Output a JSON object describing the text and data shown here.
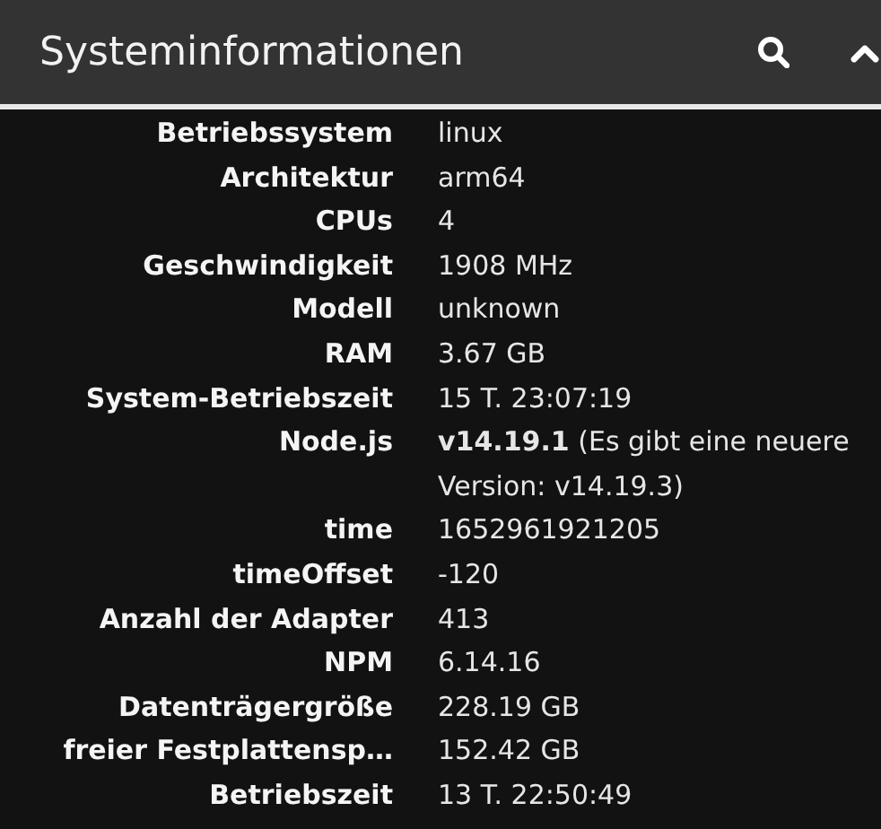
{
  "header": {
    "title": "Systeminformationen"
  },
  "rows": [
    {
      "label": "Betriebssystem",
      "value": "linux"
    },
    {
      "label": "Architektur",
      "value": "arm64"
    },
    {
      "label": "CPUs",
      "value": "4"
    },
    {
      "label": "Geschwindigkeit",
      "value": "1908 MHz"
    },
    {
      "label": "Modell",
      "value": "unknown"
    },
    {
      "label": "RAM",
      "value": "3.67 GB"
    },
    {
      "label": "System-Betriebszeit",
      "value": "15 T. 23:07:19"
    },
    {
      "label": "Node.js",
      "value": "**v14.19.1** (Es gibt eine neuere Version: v14.19.3)"
    },
    {
      "label": "time",
      "value": "1652961921205"
    },
    {
      "label": "timeOffset",
      "value": "-120"
    },
    {
      "label": "Anzahl der Adapter",
      "value": "413"
    },
    {
      "label": "NPM",
      "value": "6.14.16"
    },
    {
      "label": "Datenträgergröße",
      "value": "228.19 GB"
    },
    {
      "label": "freier Festplattensp…",
      "value": "152.42 GB"
    },
    {
      "label": "Betriebszeit",
      "value": "13 T. 22:50:49"
    }
  ]
}
